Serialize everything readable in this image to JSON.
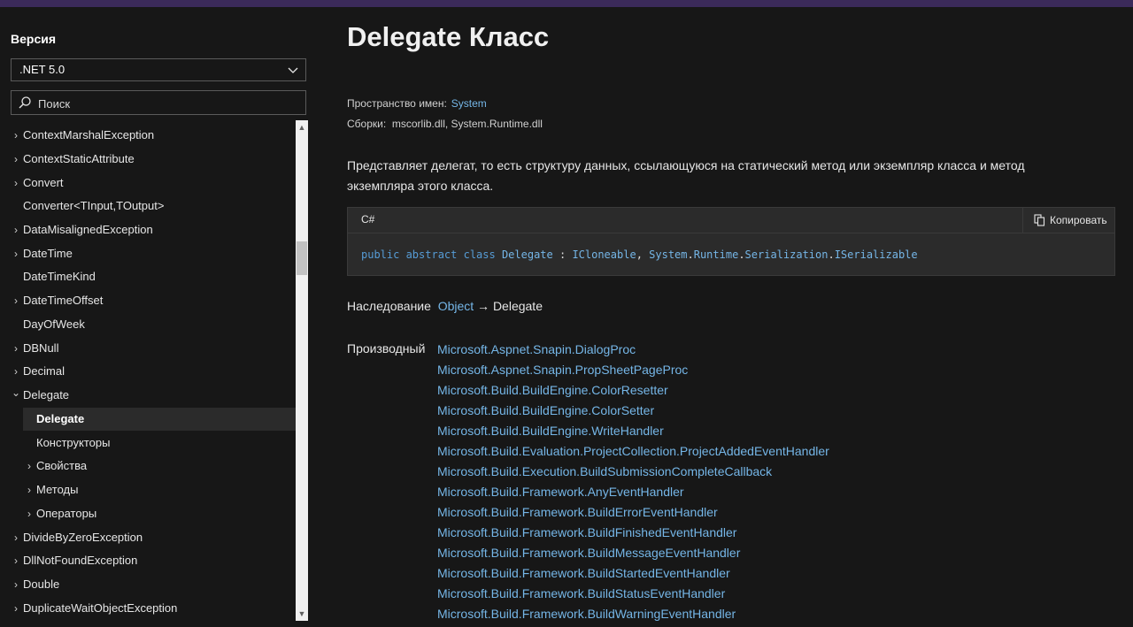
{
  "sidebar": {
    "version_label": "Версия",
    "version_value": ".NET 5.0",
    "search_placeholder": "Поиск",
    "items": [
      {
        "label": "ContextMarshalException",
        "arrow": "›"
      },
      {
        "label": "ContextStaticAttribute",
        "arrow": "›"
      },
      {
        "label": "Convert",
        "arrow": "›"
      },
      {
        "label": "Converter<TInput,TOutput>",
        "arrow": ""
      },
      {
        "label": "DataMisalignedException",
        "arrow": "›"
      },
      {
        "label": "DateTime",
        "arrow": "›"
      },
      {
        "label": "DateTimeKind",
        "arrow": ""
      },
      {
        "label": "DateTimeOffset",
        "arrow": "›"
      },
      {
        "label": "DayOfWeek",
        "arrow": ""
      },
      {
        "label": "DBNull",
        "arrow": "›"
      },
      {
        "label": "Decimal",
        "arrow": "›"
      },
      {
        "label": "Delegate",
        "arrow": "⌄"
      },
      {
        "label": "Delegate",
        "arrow": ""
      },
      {
        "label": "Конструкторы",
        "arrow": ""
      },
      {
        "label": "Свойства",
        "arrow": "›"
      },
      {
        "label": "Методы",
        "arrow": "›"
      },
      {
        "label": "Операторы",
        "arrow": "›"
      },
      {
        "label": "DivideByZeroException",
        "arrow": "›"
      },
      {
        "label": "DllNotFoundException",
        "arrow": "›"
      },
      {
        "label": "Double",
        "arrow": "›"
      },
      {
        "label": "DuplicateWaitObjectException",
        "arrow": "›"
      }
    ]
  },
  "main": {
    "title": "Delegate Класс",
    "namespace_label": "Пространство имен:",
    "namespace_value": "System",
    "assemblies_label": "Сборки:",
    "assemblies_value": "mscorlib.dll, System.Runtime.dll",
    "description": "Представляет делегат, то есть структуру данных, ссылающуюся на статический метод или экземпляр класса и метод экземпляра этого класса.",
    "code": {
      "lang": "C#",
      "copy_label": "Копировать",
      "kw1": "public abstract class",
      "class_name": "Delegate",
      "sep": " : ",
      "iface1": "ICloneable",
      "comma": ", ",
      "ns1": "System",
      "ns2": "Runtime",
      "ns3": "Serialization",
      "iface2": "ISerializable"
    },
    "inheritance_label": "Наследование",
    "inheritance_link": "Object",
    "inheritance_arrow": "→",
    "inheritance_current": "Delegate",
    "derived_label": "Производный",
    "derived": [
      "Microsoft.Aspnet.Snapin.DialogProc",
      "Microsoft.Aspnet.Snapin.PropSheetPageProc",
      "Microsoft.Build.BuildEngine.ColorResetter",
      "Microsoft.Build.BuildEngine.ColorSetter",
      "Microsoft.Build.BuildEngine.WriteHandler",
      "Microsoft.Build.Evaluation.ProjectCollection.ProjectAddedEventHandler",
      "Microsoft.Build.Execution.BuildSubmissionCompleteCallback",
      "Microsoft.Build.Framework.AnyEventHandler",
      "Microsoft.Build.Framework.BuildErrorEventHandler",
      "Microsoft.Build.Framework.BuildFinishedEventHandler",
      "Microsoft.Build.Framework.BuildMessageEventHandler",
      "Microsoft.Build.Framework.BuildStartedEventHandler",
      "Microsoft.Build.Framework.BuildStatusEventHandler",
      "Microsoft.Build.Framework.BuildWarningEventHandler"
    ]
  }
}
